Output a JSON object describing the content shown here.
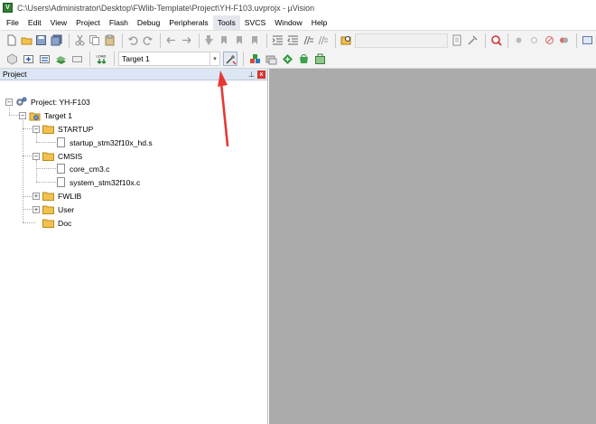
{
  "window": {
    "title": "C:\\Users\\Administrator\\Desktop\\FWlib-Template\\Project\\YH-F103.uvprojx - µVision",
    "app_icon": "V"
  },
  "menu": [
    "File",
    "Edit",
    "View",
    "Project",
    "Flash",
    "Debug",
    "Peripherals",
    "Tools",
    "SVCS",
    "Window",
    "Help"
  ],
  "menu_active": "Tools",
  "toolbar": {
    "find_value": "",
    "target_value": "Target 1",
    "target_dropdown_arrow": "▾"
  },
  "project_panel": {
    "title": "Project",
    "pin_symbol": "⊥",
    "close_symbol": "x",
    "tree": {
      "project_label": "Project: YH-F103",
      "target_label": "Target 1",
      "groups": [
        {
          "label": "STARTUP",
          "expanded": true,
          "files": [
            "startup_stm32f10x_hd.s"
          ]
        },
        {
          "label": "CMSIS",
          "expanded": true,
          "files": [
            "core_cm3.c",
            "system_stm32f10x.c"
          ]
        },
        {
          "label": "FWLIB",
          "expanded": false,
          "files": []
        },
        {
          "label": "User",
          "expanded": false,
          "files": []
        },
        {
          "label": "Doc",
          "expanded": false,
          "files": []
        }
      ],
      "expander_collapsed": "+",
      "expander_expanded": "−"
    }
  },
  "colors": {
    "editor_background": "#ababab",
    "panel_header": "#dde6f4",
    "annotation_arrow": "#e53935",
    "folder": "#f2c14e"
  }
}
